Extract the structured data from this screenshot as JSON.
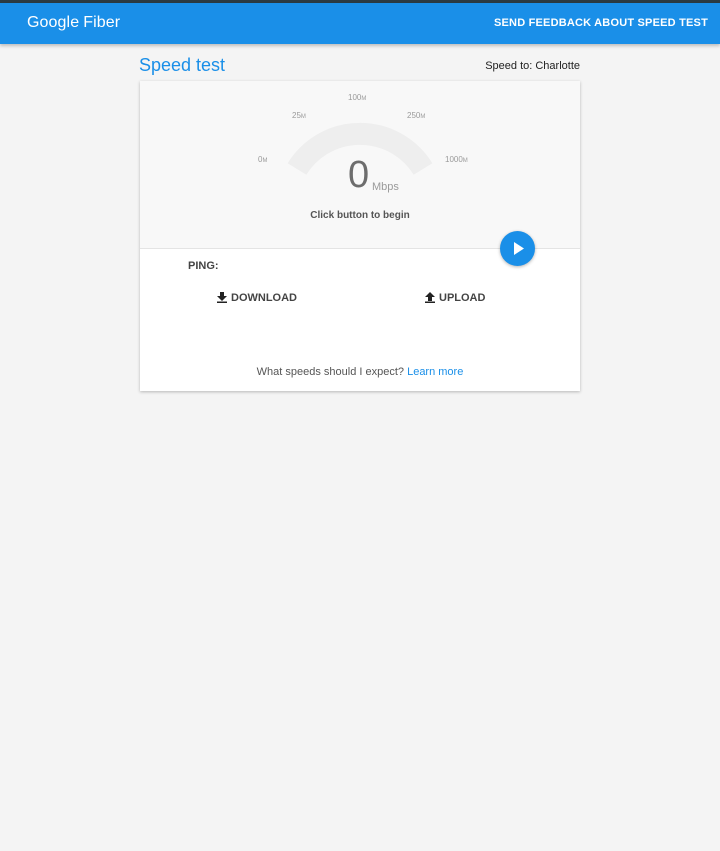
{
  "header": {
    "brand_google": "Google",
    "brand_fiber": "Fiber",
    "feedback_label": "SEND FEEDBACK ABOUT SPEED TEST",
    "background_color": "#1a8fe8"
  },
  "page": {
    "title": "Speed test",
    "speed_to": "Speed to: Charlotte"
  },
  "gauge": {
    "value": "0",
    "unit": "Mbps",
    "status": "Click button to begin",
    "ticks": [
      {
        "num": "0",
        "unit": "M"
      },
      {
        "num": "25",
        "unit": "M"
      },
      {
        "num": "100",
        "unit": "M"
      },
      {
        "num": "250",
        "unit": "M"
      },
      {
        "num": "1000",
        "unit": "M"
      }
    ]
  },
  "results": {
    "ping_label": "PING:",
    "download_label": "DOWNLOAD",
    "upload_label": "UPLOAD"
  },
  "footer": {
    "question": "What speeds should I expect?",
    "learn_more": "Learn more"
  },
  "icons": {
    "play": "play-icon",
    "download": "download-icon",
    "upload": "upload-icon"
  }
}
